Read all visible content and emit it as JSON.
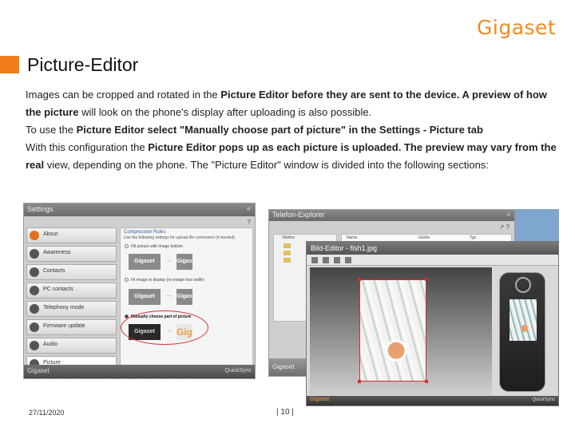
{
  "brand": "Gigaset",
  "title": "Picture-Editor",
  "paragraphs": [
    [
      {
        "t": "Images can be cropped and rotated in the ",
        "b": false
      },
      {
        "t": "Picture Editor before they are sent to the device. A preview of how the picture",
        "b": true
      },
      {
        "t": " will look on the phone's display after uploading is also possible.",
        "b": false
      }
    ],
    [
      {
        "t": "To use the ",
        "b": false
      },
      {
        "t": "Picture Editor select \"Manually choose part of picture\" in the Settings - Picture tab",
        "b": true
      }
    ],
    [
      {
        "t": "With this configuration the ",
        "b": false
      },
      {
        "t": "Picture Editor pops up as each picture is uploaded. The preview may vary from the real",
        "b": true
      },
      {
        "t": " view, depending on the phone. The \"Picture Editor\" window is divided into the following sections:",
        "b": false
      }
    ]
  ],
  "settings_window": {
    "title": "Settings",
    "chevron": "«",
    "help": "?",
    "sidebar": [
      "About",
      "Awareness",
      "Contacts",
      "PC contacts",
      "Telephony mode",
      "Firmware update",
      "Audio",
      "Picture"
    ],
    "group_label": "Compression Rules",
    "description": "Use the following settings for upload file conversion (if needed)",
    "options": [
      "Fill picture with image bottom",
      "Fit image to display (no image loss width)",
      "Manually choose part of picture"
    ],
    "thumb_label": "Gigaset",
    "thumb_small": "Gigas",
    "thumb_crop": "Gig",
    "arrow": "→",
    "footer_brand": "Gigaset",
    "footer_right": "QuickSync"
  },
  "explorer_window": {
    "title": "Telefon-Explorer",
    "chevron": "«",
    "tools": "↗ ?",
    "columns": [
      "Name",
      "Größe",
      "Typ"
    ],
    "tree_root": "Telefon",
    "footer_brand": "Gigaset"
  },
  "editor_window": {
    "title": "Bild-Editor - fish1.jpg",
    "footer_brand": "Gigaset",
    "footer_right": "QuickSync"
  },
  "footer": {
    "date": "27/11/2020",
    "page": "| 10 |"
  }
}
